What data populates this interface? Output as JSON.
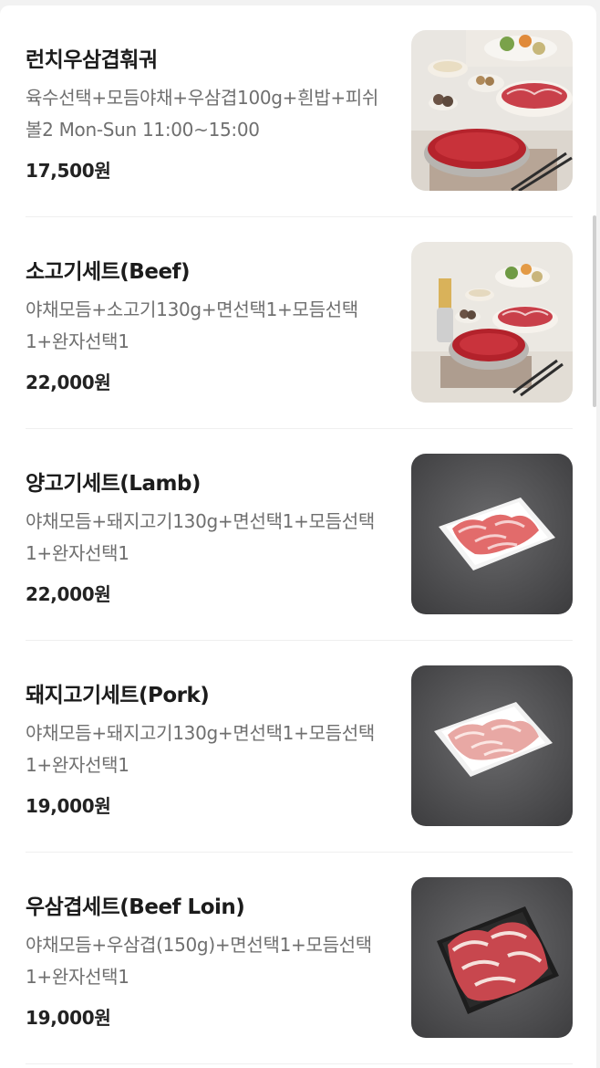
{
  "menu": {
    "items": [
      {
        "title": "런치우삼겹훠궈",
        "description": "육수선택+모듬야채+우삼겹100g+흰밥+피쉬볼2 Mon-Sun 11:00~15:00",
        "price": "17,500원",
        "photo": "hotpot-table-spread-photo"
      },
      {
        "title": "소고기세트(Beef)",
        "description": "야채모듬+소고기130g+면선택1+모듬선택1+완자선택1",
        "price": "22,000원",
        "photo": "beef-hotpot-set-photo"
      },
      {
        "title": "양고기세트(Lamb)",
        "description": "야채모듬+돼지고기130g+면선택1+모듬선택1+완자선택1",
        "price": "22,000원",
        "photo": "lamb-slices-plate-photo"
      },
      {
        "title": "돼지고기세트(Pork)",
        "description": "야채모듬+돼지고기130g+면선택1+모듬선택1+완자선택1",
        "price": "19,000원",
        "photo": "pork-slices-plate-photo"
      },
      {
        "title": "우삼겹세트(Beef Loin)",
        "description": "야채모듬+우삼겹(150g)+면선택1+모듬선택1+완자선택1",
        "price": "19,000원",
        "photo": "beef-loin-slices-photo"
      }
    ]
  }
}
